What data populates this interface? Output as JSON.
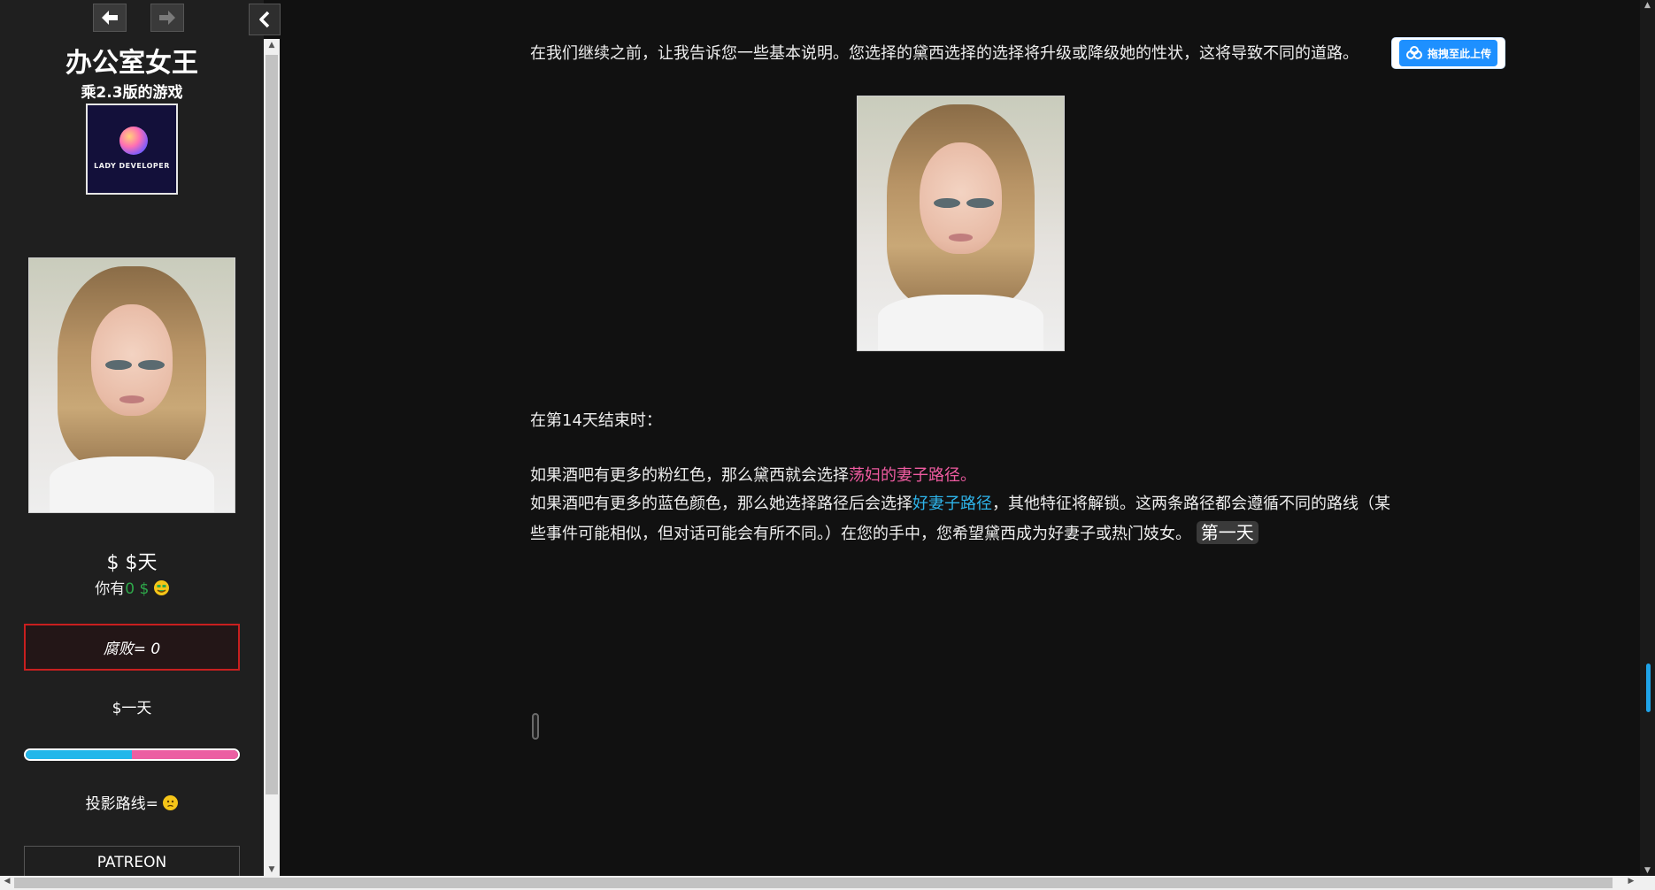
{
  "sidebar": {
    "title": "办公室女王",
    "subtitle": "乘2.3版的游戏",
    "logo_text": "LADY DEVELOPER",
    "day_text": "$ $天",
    "money": {
      "prefix": "你有",
      "amount": "0 $"
    },
    "corruption_label": "腐败= 0",
    "day_label": "$一天",
    "balance_bar": {
      "blue_fraction": 0.5,
      "pink_fraction": 0.5,
      "blue_color": "#22b7ea",
      "pink_color": "#ec5fa2"
    },
    "path_label": "投影路线=",
    "patreon_label": "PATREON"
  },
  "main": {
    "intro": "在我们继续之前，让我告诉您一些基本说明。您选择的黛西选择的选择将升级或降级她的性状，这将导致不同的道路。",
    "day14_heading": "在第14天结束时：",
    "pink_line_prefix": "如果酒吧有更多的粉红色，那么黛西就会选择",
    "pink_link": "荡妇的妻子路径。",
    "blue_line_prefix": "如果酒吧有更多的蓝色颜色，那么她选择路径后会选择",
    "blue_link": "好妻子路径",
    "blue_line_suffix": "，其他特征将解锁。这两条路径都会遵循不同的路线（某些事件可能相似，但对话可能会有所不同。）在您的手中，您希望黛西成为好妻子或热门妓女。",
    "next_day_link": "第一天"
  },
  "upload_button": {
    "label": "拖拽至此上传"
  },
  "icons": {
    "back": "arrow-left-icon",
    "forward": "arrow-right-icon",
    "toggle": "chevron-left-icon",
    "money_emoji": "money-face-emoji",
    "path_emoji": "confused-face-emoji",
    "upload": "cloud-upload-icon"
  }
}
